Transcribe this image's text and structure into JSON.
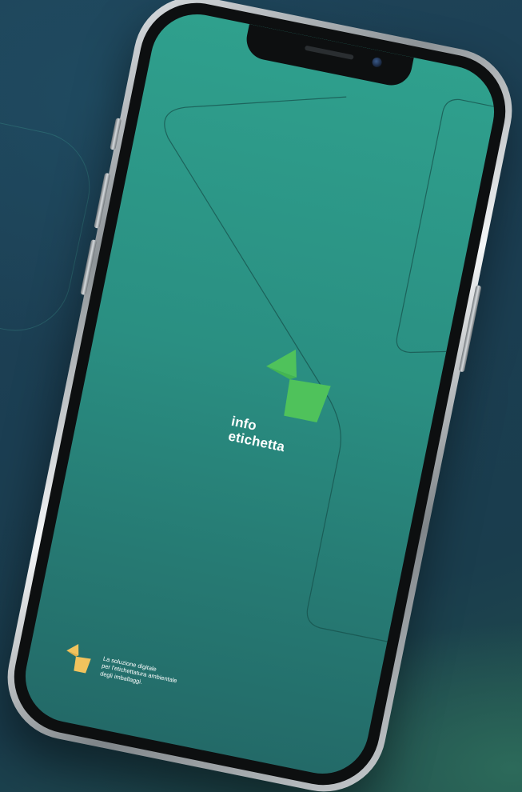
{
  "app": {
    "brand_line1": "info",
    "brand_line2": "etichetta"
  },
  "tagline": {
    "line1": "La soluzione digitale",
    "line2": "per l'etichettatura ambientale",
    "line3": "degli imballaggi."
  },
  "colors": {
    "screen_top": "#2fa08d",
    "screen_bottom": "#236a68",
    "logo_green": "#4fc25b",
    "footer_logo_yellow": "#f1c35d",
    "background": "#1c4053"
  },
  "icons": {
    "main_logo": "infoetichetta-logo-mark",
    "footer_logo": "infoetichetta-logo-mark-small"
  }
}
